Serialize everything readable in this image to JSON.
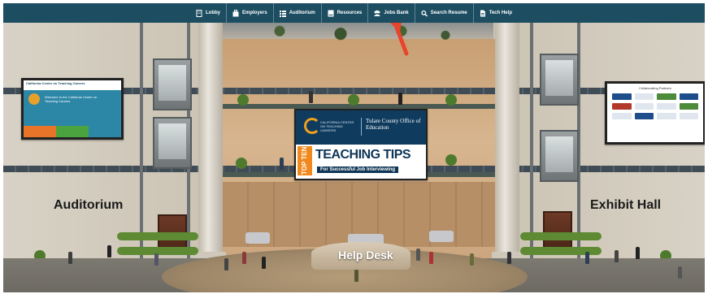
{
  "nav": {
    "items": [
      {
        "label": "Lobby",
        "icon": "building-icon"
      },
      {
        "label": "Employers",
        "icon": "briefcase-icon"
      },
      {
        "label": "Auditorium",
        "icon": "list-icon"
      },
      {
        "label": "Resources",
        "icon": "book-icon"
      },
      {
        "label": "Jobs Bank",
        "icon": "users-icon"
      },
      {
        "label": "Search Resume",
        "icon": "search-icon"
      },
      {
        "label": "Tech Help",
        "icon": "document-icon"
      }
    ],
    "background": "#1d4d61"
  },
  "scene": {
    "labels": {
      "auditorium": "Auditorium",
      "exhibit_hall": "Exhibit Hall",
      "help_desk": "Help Desk"
    },
    "center_screen": {
      "org_name": "CALIFORNIA CENTER ON TEACHING CAREERS",
      "partner_name": "Tulare County Office of Education",
      "badge": "TOP TEN",
      "headline": "TEACHING TIPS",
      "subheadline": "For Successful Job Interviewing"
    },
    "left_screen": {
      "header": "California Center on Teaching Careers",
      "text": "Welcome to the California Center on Teaching Careers"
    },
    "right_screen": {
      "title": "Collaborating Partners"
    },
    "annotation_arrow_color": "#e8452c"
  }
}
